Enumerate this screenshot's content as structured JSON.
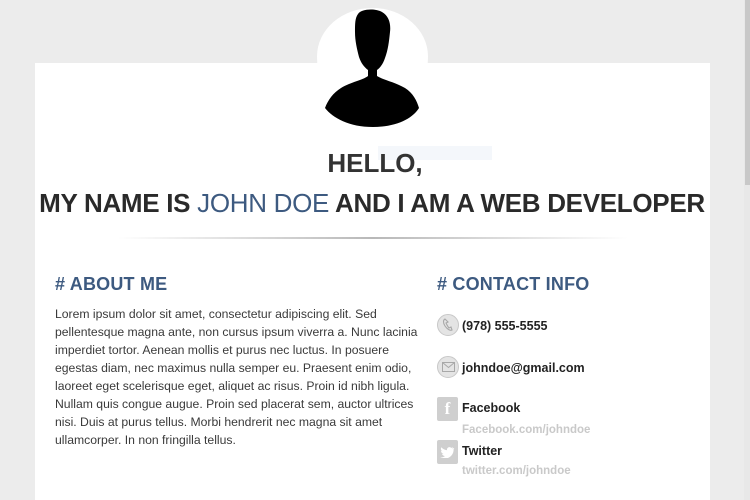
{
  "header": {
    "greeting": "HELLO,",
    "headline_prefix": "MY NAME IS ",
    "headline_name": "JOHN DOE",
    "headline_suffix": " AND I AM A WEB DEVELOPER",
    "avatar_icon": "user-silhouette-icon"
  },
  "about": {
    "title": "# ABOUT ME",
    "text": "Lorem ipsum dolor sit amet, consectetur adipiscing elit. Sed pellentesque magna ante, non cursus ipsum viverra a. Nunc lacinia imperdiet tortor. Aenean mollis et purus nec luctus. In posuere egestas diam, nec maximus nulla semper eu. Praesent enim odio, laoreet eget scelerisque eget, aliquet ac risus. Proin id nibh ligula. Nullam quis congue augue. Proin sed placerat sem, auctor ultrices nisi. Duis at purus tellus. Morbi hendrerit nec magna sit amet ullamcorper. In non fringilla tellus."
  },
  "contact": {
    "title": "# CONTACT INFO",
    "phone": {
      "value": "(978) 555-5555",
      "icon": "phone-icon"
    },
    "email": {
      "value": "johndoe@gmail.com",
      "icon": "mail-icon"
    },
    "facebook": {
      "label": "Facebook",
      "link": "Facebook.com/johndoe",
      "icon": "facebook-icon"
    },
    "twitter": {
      "label": "Twitter",
      "link": "twitter.com/johndoe",
      "icon": "twitter-icon"
    }
  },
  "colors": {
    "accent": "#3d5a80",
    "page_background": "#ececec",
    "card_background": "#ffffff",
    "muted_link": "#c9c9c9"
  }
}
